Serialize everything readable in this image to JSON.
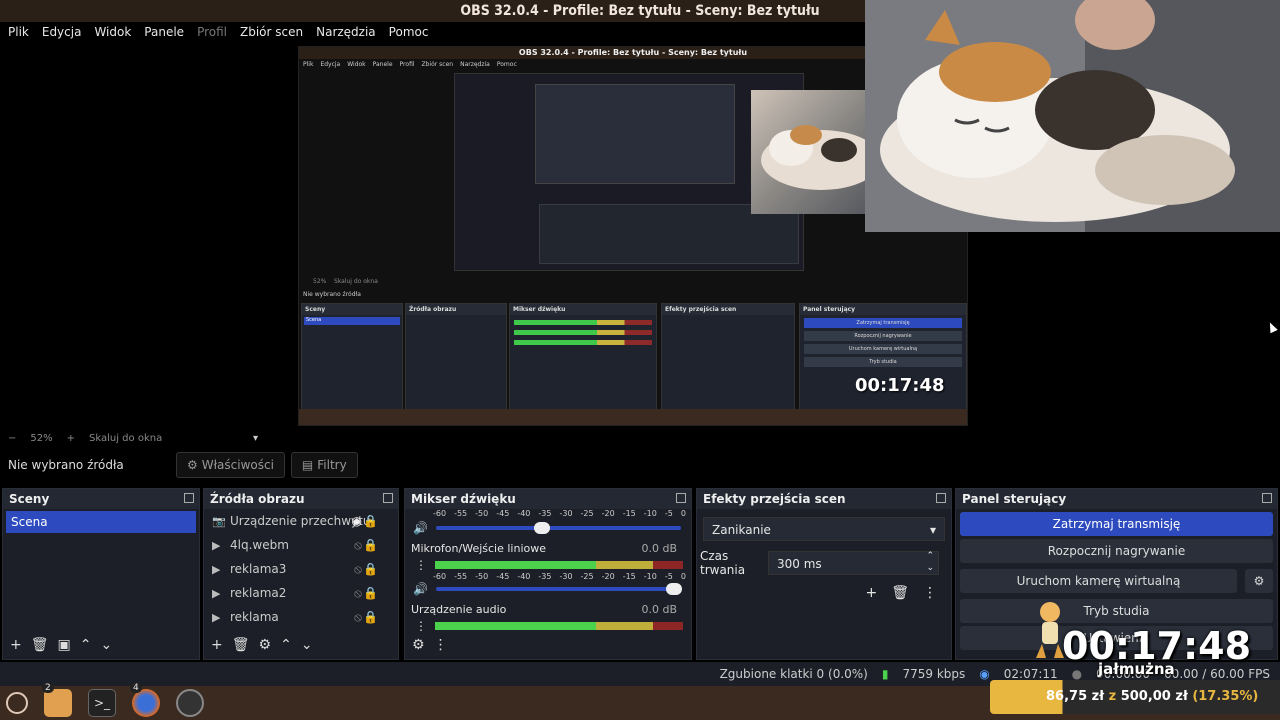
{
  "window": {
    "title": "OBS 32.0.4 - Profile: Bez tytułu - Sceny: Bez tytułu"
  },
  "menu": [
    {
      "label": "Plik",
      "enabled": true
    },
    {
      "label": "Edycja",
      "enabled": true
    },
    {
      "label": "Widok",
      "enabled": true
    },
    {
      "label": "Panele",
      "enabled": true
    },
    {
      "label": "Profil",
      "enabled": false
    },
    {
      "label": "Zbiór scen",
      "enabled": true
    },
    {
      "label": "Narzędzia",
      "enabled": true
    },
    {
      "label": "Pomoc",
      "enabled": true
    }
  ],
  "zoom": {
    "value": "52%",
    "minus": "−",
    "plus": "+",
    "fit": "Skaluj do okna"
  },
  "source_bar": {
    "none_selected": "Nie wybrano źródła",
    "properties": "Właściwości",
    "filters": "Filtry"
  },
  "scenes": {
    "title": "Sceny",
    "items": [
      "Scena"
    ]
  },
  "sources": {
    "title": "Źródła obrazu",
    "items": [
      {
        "name": "Urządzenie przechwytu",
        "icon": "camera-icon",
        "visible": true
      },
      {
        "name": "4lq.webm",
        "icon": "play-icon",
        "visible": false
      },
      {
        "name": "reklama3",
        "icon": "play-icon",
        "visible": false
      },
      {
        "name": "reklama2",
        "icon": "play-icon",
        "visible": false
      },
      {
        "name": "reklama",
        "icon": "play-icon",
        "visible": false
      }
    ]
  },
  "mixer": {
    "title": "Mikser dźwięku",
    "ticks": [
      "-60",
      "-55",
      "-50",
      "-45",
      "-40",
      "-35",
      "-30",
      "-25",
      "-20",
      "-15",
      "-10",
      "-5",
      "0"
    ],
    "channels": [
      {
        "name": "Mikrofon/Wejście liniowe",
        "db": "0.0 dB",
        "level": 0.7
      },
      {
        "name": "Urządzenie audio",
        "db": "0.0 dB",
        "level": 0.55
      }
    ]
  },
  "transitions": {
    "title": "Efekty przejścia scen",
    "selected": "Zanikanie",
    "duration_label": "Czas trwania",
    "duration": "300 ms"
  },
  "controls": {
    "title": "Panel sterujący",
    "stop_stream": "Zatrzymaj transmisję",
    "start_recording": "Rozpocznij nagrywanie",
    "virtual_cam": "Uruchom kamerę wirtualną",
    "studio_mode": "Tryb studia",
    "settings": "Ustawienia"
  },
  "status": {
    "dropped": "Zgubione klatki 0 (0.0%)",
    "bitrate": "7759 kbps",
    "stream_time": "02:07:11",
    "rec_time": "00:00:00",
    "fps": "60.00 / 60.00 FPS"
  },
  "overlay": {
    "timer": "00:17:48",
    "label": "jałmużna",
    "goal_current": "86,75 zł",
    "goal_of": "z",
    "goal_target": "500,00 zł",
    "goal_pct": "(17.35%)"
  },
  "taskbar": {
    "badge_files": "2",
    "badge_firefox": "4"
  },
  "colors": {
    "accent": "#2d4bbf",
    "title_bg": "#2b2018",
    "taskbar_bg": "#3a2a20"
  }
}
